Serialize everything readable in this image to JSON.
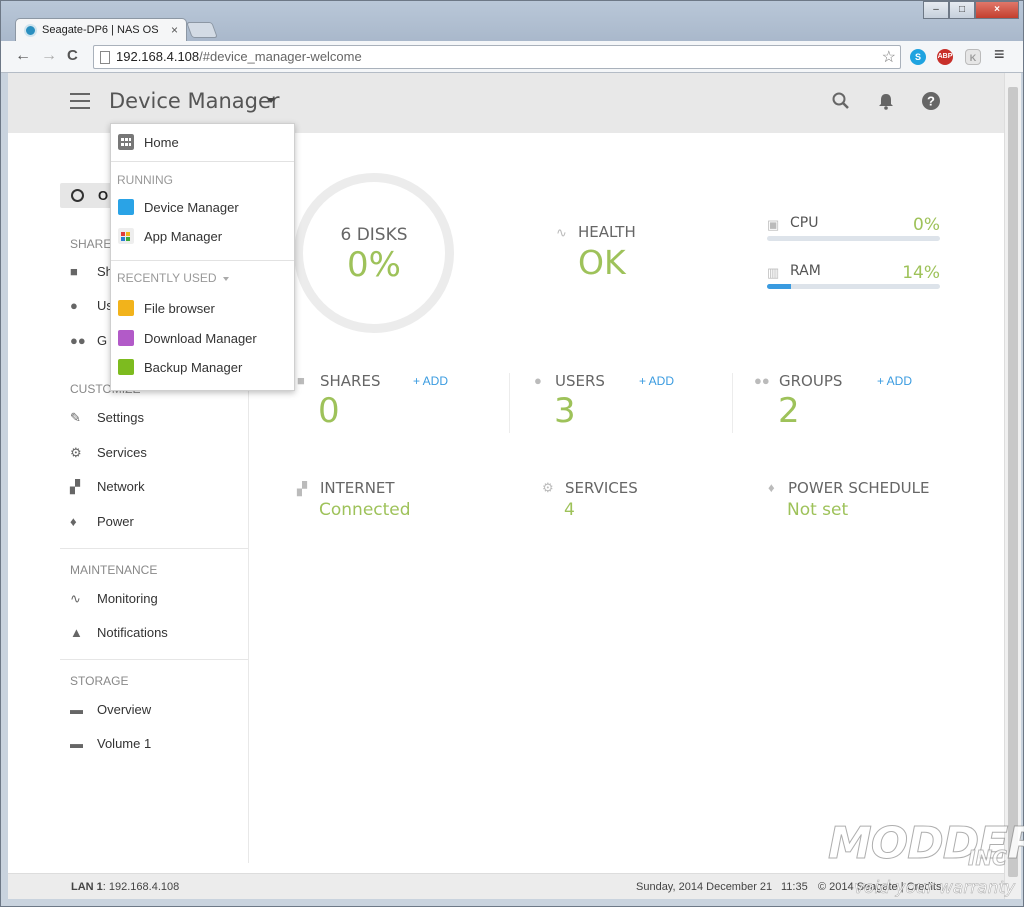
{
  "browser": {
    "tab_title": "Seagate-DP6 | NAS OS",
    "tab_close": "×",
    "window_min": "–",
    "window_max": "□",
    "window_close": "×",
    "back": "←",
    "forward": "→",
    "reload": "C",
    "url_host": "192.168.4.108",
    "url_path": "/#device_manager-welcome",
    "star": "☆",
    "ext_skype": "S",
    "ext_abp": "ABP",
    "ext_k": "K",
    "menu": "≡"
  },
  "header": {
    "title": "Device Manager"
  },
  "dropdown": {
    "home": "Home",
    "running_heading": "RUNNING",
    "running": [
      "Device Manager",
      "App Manager"
    ],
    "recent_heading": "RECENTLY USED",
    "recent": [
      "File browser",
      "Download Manager",
      "Backup Manager"
    ]
  },
  "sidebar": {
    "active_letter": "O",
    "shares_heading": "SHARE",
    "shares_items": [
      "Sh",
      "Us",
      "G"
    ],
    "customize_heading": "CUSTOMIZE",
    "customize_items": [
      "Settings",
      "Services",
      "Network",
      "Power"
    ],
    "maintenance_heading": "MAINTENANCE",
    "maintenance_items": [
      "Monitoring",
      "Notifications"
    ],
    "storage_heading": "STORAGE",
    "storage_items": [
      "Overview",
      "Volume 1"
    ]
  },
  "dashboard": {
    "disks_label": "6 DISKS",
    "disks_value": "0%",
    "health_label": "HEALTH",
    "health_value": "OK",
    "cpu_label": "CPU",
    "cpu_value": "0%",
    "cpu_percent": 0,
    "ram_label": "RAM",
    "ram_value": "14%",
    "ram_percent": 14,
    "shares_label": "SHARES",
    "shares_add": "+ ADD",
    "shares_count": "0",
    "users_label": "USERS",
    "users_add": "+ ADD",
    "users_count": "3",
    "groups_label": "GROUPS",
    "groups_add": "+ ADD",
    "groups_count": "2",
    "internet_label": "INTERNET",
    "internet_value": "Connected",
    "services_label": "SERVICES",
    "services_value": "4",
    "power_label": "POWER SCHEDULE",
    "power_value": "Not set"
  },
  "footer": {
    "lan_label": "LAN 1",
    "lan_value": ": 192.168.4.108",
    "date": "Sunday, 2014 December 21",
    "time": "11:35",
    "copyright": "© 2014 Seagate | Credits"
  },
  "watermark": {
    "line1": "MODDERS",
    "line2": "INC",
    "line3": "void your warranty"
  },
  "colors": {
    "accent_green": "#9ec25a",
    "accent_blue": "#3a9be0"
  }
}
